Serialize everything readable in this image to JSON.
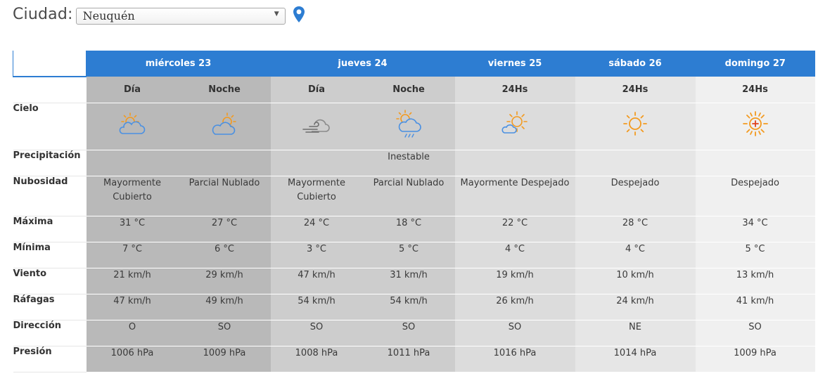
{
  "header": {
    "city_label": "Ciudad:",
    "city_selected": "Neuquén",
    "location_icon": "map-pin-icon"
  },
  "colors": {
    "header_blue": "#2d7dd2",
    "sun_orange": "#f39a1f",
    "cloud_blue": "#4a90e2"
  },
  "table": {
    "days": [
      {
        "label": "miércoles 23"
      },
      {
        "label": "jueves 24"
      },
      {
        "label": "viernes 25"
      },
      {
        "label": "sábado 26"
      },
      {
        "label": "domingo 27"
      }
    ],
    "periods": [
      "Día",
      "Noche",
      "Día",
      "Noche",
      "24Hs",
      "24Hs",
      "24Hs"
    ],
    "row_labels": {
      "sky": "Cielo",
      "precip": "Precipitación",
      "nub": "Nubosidad",
      "max": "Máxima",
      "min": "Mínima",
      "wind": "Viento",
      "gust": "Ráfagas",
      "dir": "Dirección",
      "pres": "Presión"
    },
    "sky_icons": [
      "partly-cloudy-day-icon",
      "partly-cloudy-night-icon",
      "cloudy-windy-icon",
      "rain-showers-icon",
      "mostly-sunny-icon",
      "sunny-icon",
      "hot-sunny-icon"
    ],
    "precip": [
      "",
      "",
      "",
      "Inestable",
      "",
      "",
      ""
    ],
    "nubosidad": [
      "Mayormente Cubierto",
      "Parcial Nublado",
      "Mayormente Cubierto",
      "Parcial Nublado",
      "Mayormente Despejado",
      "Despejado",
      "Despejado"
    ],
    "max": [
      "31 °C",
      "27 °C",
      "24 °C",
      "18 °C",
      "22 °C",
      "28 °C",
      "34 °C"
    ],
    "min": [
      "7 °C",
      "6 °C",
      "3 °C",
      "5 °C",
      "4 °C",
      "4 °C",
      "5 °C"
    ],
    "wind": [
      "21 km/h",
      "29 km/h",
      "47 km/h",
      "31 km/h",
      "19 km/h",
      "10 km/h",
      "13 km/h"
    ],
    "gust": [
      "47 km/h",
      "49 km/h",
      "54 km/h",
      "54 km/h",
      "26 km/h",
      "24 km/h",
      "41 km/h"
    ],
    "dir": [
      "O",
      "SO",
      "SO",
      "SO",
      "SO",
      "NE",
      "SO"
    ],
    "pres": [
      "1006 hPa",
      "1009 hPa",
      "1008 hPa",
      "1011 hPa",
      "1016 hPa",
      "1014 hPa",
      "1009 hPa"
    ]
  }
}
